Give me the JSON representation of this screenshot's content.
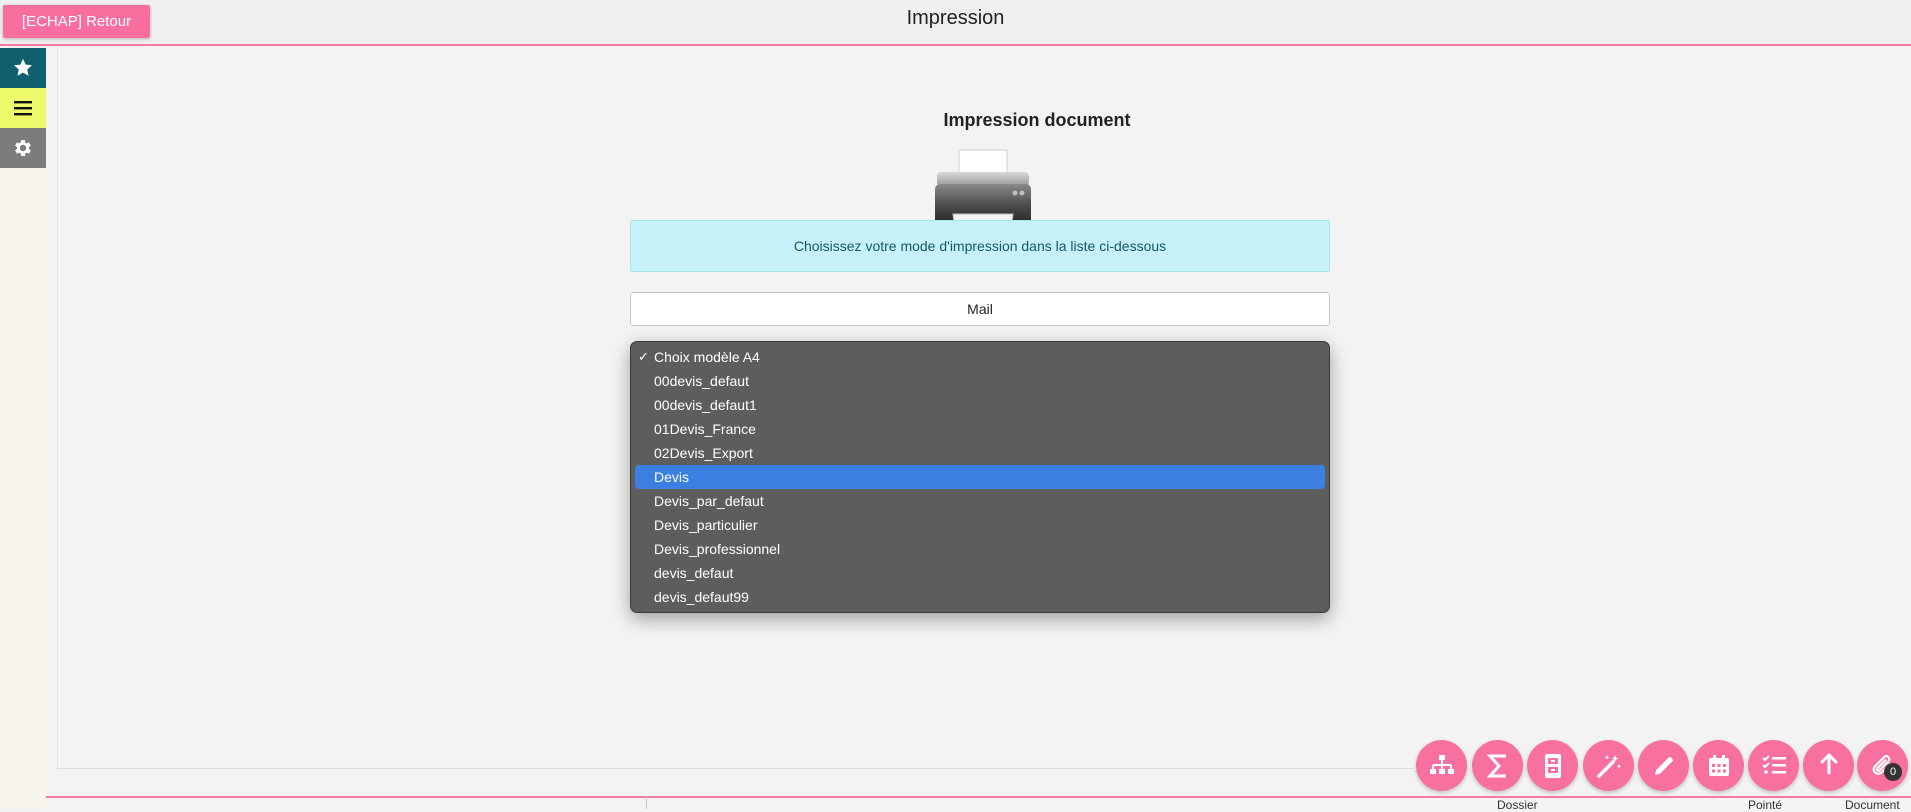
{
  "header": {
    "back_label": "[ECHAP] Retour",
    "title": "Impression"
  },
  "sidebar": {
    "items": [
      {
        "icon": "star-icon",
        "color": "#0f5f6e"
      },
      {
        "icon": "menu-icon",
        "color": "#eef96a"
      },
      {
        "icon": "gear-icon",
        "color": "#7b7c7d"
      }
    ]
  },
  "main": {
    "doc_title": "Impression document",
    "printer_icon": "printer-icon",
    "info_text": "Choisissez votre mode d'impression dans la liste ci-dessous",
    "mode_value": "Mail",
    "template_select": {
      "checked_option": "Choix modèle A4",
      "highlighted_option": "Devis",
      "options": [
        "Choix modèle A4",
        "00devis_defaut",
        "00devis_defaut1",
        "01Devis_France",
        "02Devis_Export",
        "Devis",
        "Devis_par_defaut",
        "Devis_particulier",
        "Devis_professionnel",
        "devis_defaut",
        "devis_defaut99"
      ]
    }
  },
  "bottom": {
    "labels": [
      "Dossier",
      "Pointé",
      "Document"
    ]
  },
  "fabs": [
    {
      "icon": "org-chart-icon"
    },
    {
      "icon": "sum-icon"
    },
    {
      "icon": "archive-icon"
    },
    {
      "icon": "magic-wand-icon"
    },
    {
      "icon": "pencil-icon"
    },
    {
      "icon": "calendar-icon"
    },
    {
      "icon": "checklist-icon"
    },
    {
      "icon": "arrow-up-icon"
    },
    {
      "icon": "paperclip-icon",
      "badge": "0"
    }
  ],
  "colors": {
    "accent": "#f8709f",
    "info_bg": "#c6f1f8",
    "selection": "#3b7fe0"
  }
}
